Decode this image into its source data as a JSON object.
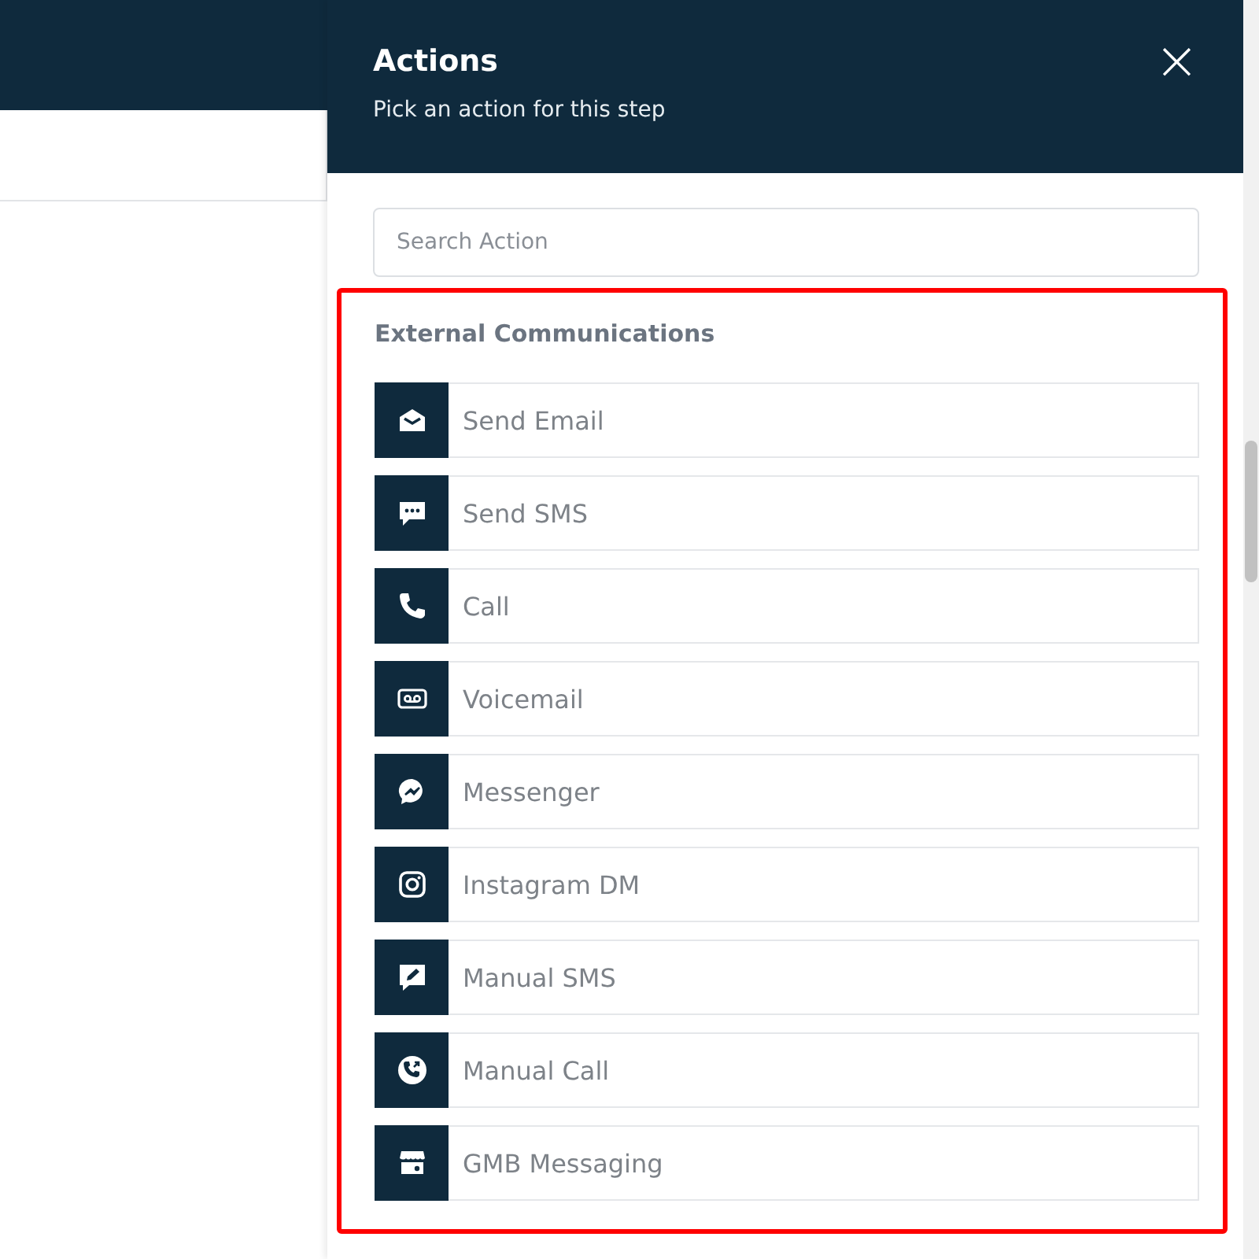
{
  "panel": {
    "title": "Actions",
    "subtitle": "Pick an action for this step",
    "close": "×"
  },
  "search": {
    "placeholder": "Search Action"
  },
  "section": {
    "heading": "External Communications",
    "highlighted": true,
    "items": [
      {
        "label": "Send Email",
        "kind": "email"
      },
      {
        "label": "Send SMS",
        "kind": "sms"
      },
      {
        "label": "Call",
        "kind": "call"
      },
      {
        "label": "Voicemail",
        "kind": "voicemail"
      },
      {
        "label": "Messenger",
        "kind": "messenger"
      },
      {
        "label": "Instagram DM",
        "kind": "instagram"
      },
      {
        "label": "Manual SMS",
        "kind": "manual-sms"
      },
      {
        "label": "Manual Call",
        "kind": "manual-call"
      },
      {
        "label": "GMB Messaging",
        "kind": "store"
      }
    ]
  }
}
